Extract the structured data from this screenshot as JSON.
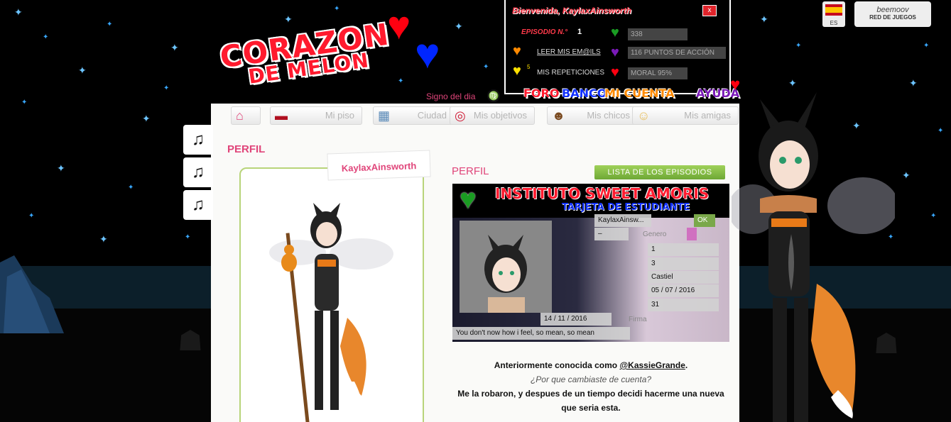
{
  "logo": {
    "line1": "CORAZON",
    "line2": "DE MELON"
  },
  "signo": {
    "label": "Signo del dia",
    "symbol": "♍"
  },
  "infobox": {
    "welcome": "Bienvenida, KaylaxAinsworth",
    "close": "x",
    "episode_label": "EPISODIO N.°",
    "episode_number": "1",
    "emails_link": "LEER MIS EM@ILS",
    "replays_link": "MIS REPETICIONES",
    "replays_count": "5",
    "dollars": "338",
    "action_points": "116 PUNTOS DE ACCIÓN",
    "moral": "MORAL 95%"
  },
  "topnav": {
    "foro": "FORO",
    "banco": "BANCO",
    "mi_cuenta": "MI CUENTA",
    "ayuda": "AYUDA"
  },
  "lang": {
    "code": "ES"
  },
  "beemoov": {
    "name": "beemoov",
    "subtitle": "RED DE JUEGOS"
  },
  "tabs": [
    {
      "label": ""
    },
    {
      "label": "Mi piso"
    },
    {
      "label": "Ciudad"
    },
    {
      "label": "Mis objetivos"
    },
    {
      "label": "Mis chicos"
    },
    {
      "label": "Mis amigas"
    }
  ],
  "profile": {
    "heading": "PERFIL",
    "username": "KaylaxAinsworth",
    "heading2": "PERFIL",
    "episodes_button": "LISTA DE LOS EPISODIOS"
  },
  "card": {
    "title": "INSTITUTO SWEET AMORIS",
    "subtitle": "TARJETA DE ESTUDIANTE",
    "username": "KaylaxAinsw...",
    "dash": "–",
    "gender_label": "Genero",
    "field_1": "1",
    "field_3": "3",
    "boy": "Castiel",
    "date1": "05 / 07 / 2016",
    "num31": "31",
    "date2": "14 / 11 / 2016",
    "firma": "Firma",
    "quote": "You don't now how i feel, so mean, so mean",
    "ok": "OK"
  },
  "description": {
    "line1_pre": "Anteriormente conocida como ",
    "line1_mention": "@KassieGrande",
    "line1_post": ".",
    "line2": "¿Por que cambiaste de cuenta?",
    "line3": "Me la robaron, y despues de un tiempo decidi hacerme una nueva",
    "line4": "que seria esta."
  },
  "colors": {
    "accent_pink": "#e0457a",
    "brand_red": "#ff1a2e",
    "tab_green": "#6ea835",
    "frame_green": "#b8d47a"
  }
}
